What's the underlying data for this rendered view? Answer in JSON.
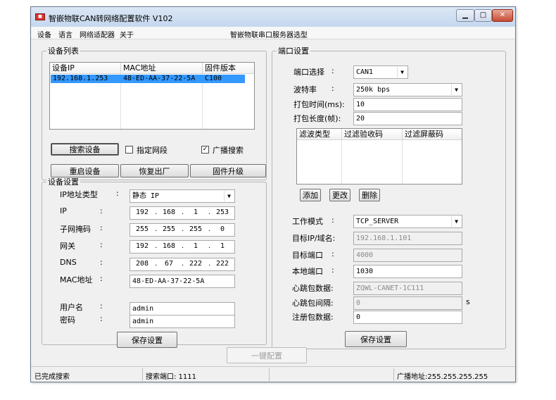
{
  "window": {
    "title": "智嵌物联CAN转网络配置软件   V102"
  },
  "menu": {
    "items": [
      "设备",
      "语言",
      "网络适配器",
      "关于"
    ],
    "model_label": "智嵌物联串口服务器选型"
  },
  "device_list": {
    "title": "设备列表",
    "columns": [
      "设备IP",
      "MAC地址",
      "固件版本"
    ],
    "rows": [
      {
        "ip": "192.168.1.253",
        "mac": "48-ED-AA-37-22-5A",
        "fw": "C100"
      }
    ],
    "search_button": "搜索设备",
    "specify_segment_label": "指定网段",
    "specify_segment_checked": false,
    "broadcast_label": "广播搜索",
    "broadcast_checked": true,
    "reboot_button": "重启设备",
    "factory_button": "恢复出厂",
    "firmware_button": "固件升级"
  },
  "device_settings": {
    "title": "设备设置",
    "ip_type_label": "IP地址类型",
    "ip_type_value": "静态 IP",
    "ip_label": "IP",
    "ip": [
      "192",
      "168",
      "1",
      "253"
    ],
    "mask_label": "子网掩码",
    "mask": [
      "255",
      "255",
      "255",
      "0"
    ],
    "gateway_label": "网关",
    "gateway": [
      "192",
      "168",
      "1",
      "1"
    ],
    "dns_label": "DNS",
    "dns": [
      "208",
      "67",
      "222",
      "222"
    ],
    "mac_label": "MAC地址",
    "mac_value": "48-ED-AA-37-22-5A",
    "username_label": "用户名",
    "username_value": "admin",
    "password_label": "密码",
    "password_value": "admin",
    "save_button": "保存设置"
  },
  "port_settings": {
    "title": "端口设置",
    "port_label": "端口选择",
    "port_value": "CAN1",
    "baud_label": "波特率",
    "baud_value": "250k  bps",
    "pack_time_label": "打包时间(ms):",
    "pack_time_value": "10",
    "pack_len_label": "打包长度(帧):",
    "pack_len_value": "20",
    "filter_columns": [
      "滤波类型",
      "过滤验收码",
      "过滤屏蔽码"
    ],
    "add_button": "添加",
    "edit_button": "更改",
    "delete_button": "删除",
    "mode_label": "工作模式",
    "mode_value": "TCP_SERVER",
    "target_ip_label": "目标IP/域名:",
    "target_ip_value": "192.168.1.101",
    "target_port_label": "目标端口",
    "target_port_value": "4000",
    "local_port_label": "本地端口",
    "local_port_value": "1030",
    "heartbeat_data_label": "心跳包数据:",
    "heartbeat_data_value": "ZQWL-CANET-1C111",
    "heartbeat_interval_label": "心跳包间隔:",
    "heartbeat_interval_value": "0",
    "heartbeat_unit": "s",
    "register_label": "注册包数据:",
    "register_value": "0",
    "save_button": "保存设置"
  },
  "one_key_button": "一键配置",
  "status": {
    "left": "已完成搜索",
    "search_port": "搜索端口: 1111",
    "broadcast": "广播地址:255.255.255.255"
  }
}
